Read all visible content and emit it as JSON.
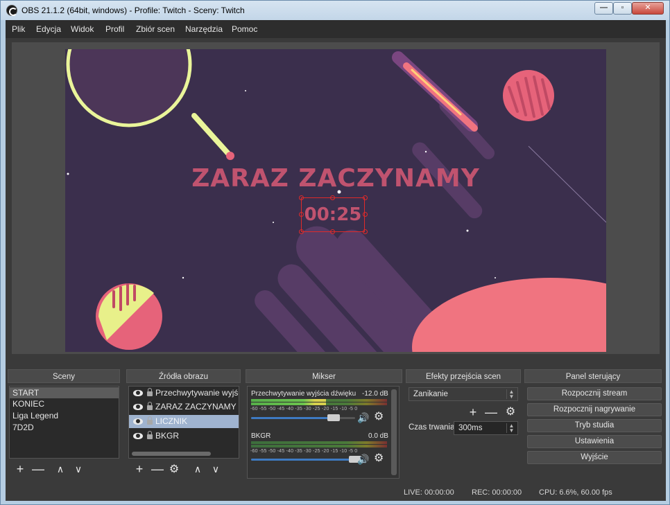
{
  "window": {
    "title": "OBS 21.1.2 (64bit, windows) - Profile: Twitch - Sceny: Twitch",
    "min_label": "—",
    "max_label": "▫",
    "close_label": "✕"
  },
  "menu": {
    "items": [
      "Plik",
      "Edycja",
      "Widok",
      "Profil",
      "Zbiór scen",
      "Narzędzia",
      "Pomoc"
    ]
  },
  "preview": {
    "headline": "ZARAZ ZACZYNAMY",
    "timer": "00:25",
    "colors": {
      "background": "#3b2f4d",
      "accent": "#c0536f",
      "planet": "#f07480",
      "ring": "#eaf59a"
    }
  },
  "docks": {
    "scenes_title": "Sceny",
    "sources_title": "Źródła obrazu",
    "mixer_title": "Mikser",
    "transitions_title": "Efekty przejścia scen",
    "controls_title": "Panel sterujący"
  },
  "scenes": {
    "items": [
      "START",
      "KONIEC",
      "Liga Legend",
      "7D2D"
    ],
    "selected": "START"
  },
  "sources": {
    "items": [
      "Przechwytywanie wyjścia",
      "ZARAZ ZACZYNAMY",
      "LICZNIK",
      "BKGR"
    ],
    "selected": "LICZNIK"
  },
  "toolbar_icons": {
    "add": "+",
    "remove": "—",
    "up": "∧",
    "down": "∨",
    "gear": "⚙"
  },
  "mixer": {
    "channels": [
      {
        "name": "Przechwytywanie wyjścia dźwięku",
        "db": "-12.0 dB",
        "volume": 0.79,
        "level": 0.55
      },
      {
        "name": "BKGR",
        "db": "0.0 dB",
        "volume": 1.0,
        "level": 0.0
      }
    ],
    "scale": "-60 -55 -50 -45 -40 -35 -30 -25 -20 -15 -10  -5  0",
    "speaker_icon": "🔊"
  },
  "transitions": {
    "selected": "Zanikanie",
    "duration_label": "Czas trwania",
    "duration_value": "300ms"
  },
  "controls": {
    "buttons": [
      "Rozpocznij stream",
      "Rozpocznij nagrywanie",
      "Tryb studia",
      "Ustawienia",
      "Wyjście"
    ]
  },
  "status": {
    "live": "LIVE: 00:00:00",
    "rec": "REC: 00:00:00",
    "cpu": "CPU: 6.6%, 60.00 fps"
  }
}
